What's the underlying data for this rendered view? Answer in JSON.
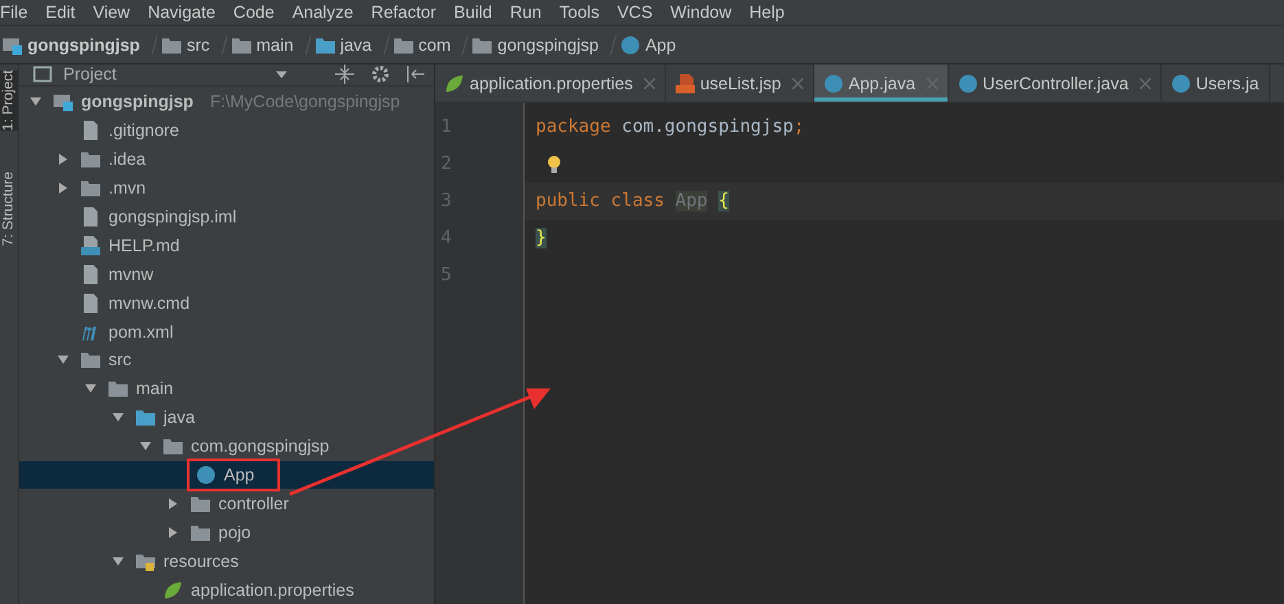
{
  "menu": [
    "File",
    "Edit",
    "View",
    "Navigate",
    "Code",
    "Analyze",
    "Refactor",
    "Build",
    "Run",
    "Tools",
    "VCS",
    "Window",
    "Help"
  ],
  "breadcrumb": [
    {
      "label": "gongspingjsp",
      "kind": "project"
    },
    {
      "label": "src",
      "kind": "folder"
    },
    {
      "label": "main",
      "kind": "folder"
    },
    {
      "label": "java",
      "kind": "source"
    },
    {
      "label": "com",
      "kind": "package"
    },
    {
      "label": "gongspingjsp",
      "kind": "package"
    },
    {
      "label": "App",
      "kind": "class"
    }
  ],
  "tool_strip": [
    {
      "label": "1: Project",
      "selected": true
    },
    {
      "label": "7: Structure",
      "selected": false
    }
  ],
  "project_panel": {
    "title": "Project",
    "tree": [
      {
        "name": "gongspingjsp",
        "kind": "project",
        "path": "F:\\MyCode\\gongspingjsp",
        "expanded": true,
        "selected": false,
        "children": [
          {
            "name": ".gitignore",
            "kind": "file",
            "selected": false
          },
          {
            "name": ".idea",
            "kind": "folder",
            "expanded": false,
            "selected": false
          },
          {
            "name": ".mvn",
            "kind": "folder",
            "expanded": false,
            "selected": false
          },
          {
            "name": "gongspingjsp.iml",
            "kind": "file",
            "selected": false
          },
          {
            "name": "HELP.md",
            "kind": "md",
            "selected": false
          },
          {
            "name": "mvnw",
            "kind": "file",
            "selected": false
          },
          {
            "name": "mvnw.cmd",
            "kind": "file",
            "selected": false
          },
          {
            "name": "pom.xml",
            "kind": "maven",
            "selected": false
          },
          {
            "name": "src",
            "kind": "folder",
            "expanded": true,
            "selected": false,
            "children": [
              {
                "name": "main",
                "kind": "folder",
                "expanded": true,
                "selected": false,
                "children": [
                  {
                    "name": "java",
                    "kind": "source",
                    "expanded": true,
                    "selected": false,
                    "children": [
                      {
                        "name": "com.gongspingjsp",
                        "kind": "package",
                        "expanded": true,
                        "selected": false,
                        "children": [
                          {
                            "name": "App",
                            "kind": "class",
                            "selected": true,
                            "highlighted": true
                          },
                          {
                            "name": "controller",
                            "kind": "package",
                            "expanded": false,
                            "selected": false
                          },
                          {
                            "name": "pojo",
                            "kind": "package",
                            "expanded": false,
                            "selected": false
                          }
                        ]
                      }
                    ]
                  },
                  {
                    "name": "resources",
                    "kind": "resources",
                    "expanded": true,
                    "selected": false,
                    "children": [
                      {
                        "name": "application.properties",
                        "kind": "properties",
                        "selected": false
                      }
                    ]
                  }
                ]
              }
            ]
          }
        ]
      }
    ]
  },
  "editor": {
    "tabs": [
      {
        "label": "application.properties",
        "kind": "properties",
        "selected": false
      },
      {
        "label": "useList.jsp",
        "kind": "jsp",
        "selected": false
      },
      {
        "label": "App.java",
        "kind": "class",
        "selected": true
      },
      {
        "label": "UserController.java",
        "kind": "class",
        "selected": false
      },
      {
        "label": "Users.ja",
        "kind": "class",
        "selected": false
      }
    ],
    "lines": [
      {
        "number": "1",
        "tokens": [
          {
            "text": "package",
            "kind": "keyword"
          },
          {
            "text": "com.gongspingjsp",
            "kind": "plain"
          },
          {
            "text": ";",
            "kind": "punct"
          }
        ]
      },
      {
        "number": "2",
        "bulb": true
      },
      {
        "number": "3",
        "tokens": [
          {
            "text": "public",
            "kind": "keyword"
          },
          {
            "text": "class",
            "kind": "keyword"
          },
          {
            "text": "App",
            "kind": "unused"
          },
          {
            "text": "{",
            "kind": "brace"
          }
        ]
      },
      {
        "number": "4",
        "tokens": [
          {
            "text": "}",
            "kind": "brace"
          }
        ]
      },
      {
        "number": "5"
      }
    ]
  }
}
